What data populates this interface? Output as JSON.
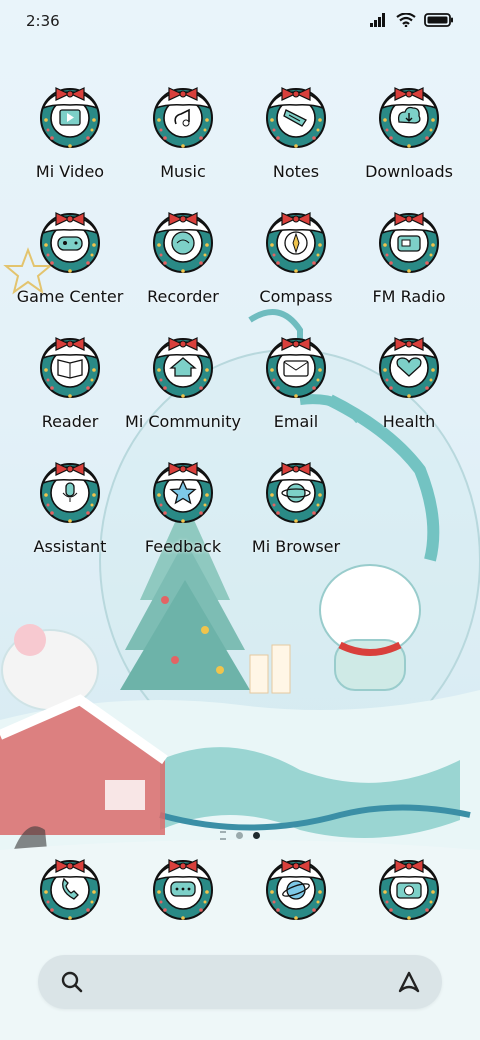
{
  "status": {
    "time": "2:36"
  },
  "apps": [
    {
      "label": "Mi Video",
      "icon": "video-icon"
    },
    {
      "label": "Music",
      "icon": "music-icon"
    },
    {
      "label": "Notes",
      "icon": "notes-icon"
    },
    {
      "label": "Downloads",
      "icon": "downloads-icon"
    },
    {
      "label": "Game Center",
      "icon": "gamepad-icon"
    },
    {
      "label": "Recorder",
      "icon": "recorder-icon"
    },
    {
      "label": "Compass",
      "icon": "compass-icon"
    },
    {
      "label": "FM Radio",
      "icon": "radio-icon"
    },
    {
      "label": "Reader",
      "icon": "book-icon"
    },
    {
      "label": "Mi Community",
      "icon": "home-icon"
    },
    {
      "label": "Email",
      "icon": "mail-icon"
    },
    {
      "label": "Health",
      "icon": "health-icon"
    },
    {
      "label": "Assistant",
      "icon": "microphone-icon"
    },
    {
      "label": "Feedback",
      "icon": "star-icon"
    },
    {
      "label": "Mi Browser",
      "icon": "planet-icon"
    }
  ],
  "dock": [
    {
      "icon": "phone-icon"
    },
    {
      "icon": "message-icon"
    },
    {
      "icon": "browser-icon"
    },
    {
      "icon": "camera-icon"
    }
  ],
  "pages": {
    "count": 2,
    "active": 2
  },
  "colors": {
    "wreath": "#2a8a86",
    "bow": "#d9403c",
    "snow": "#ffffff"
  }
}
